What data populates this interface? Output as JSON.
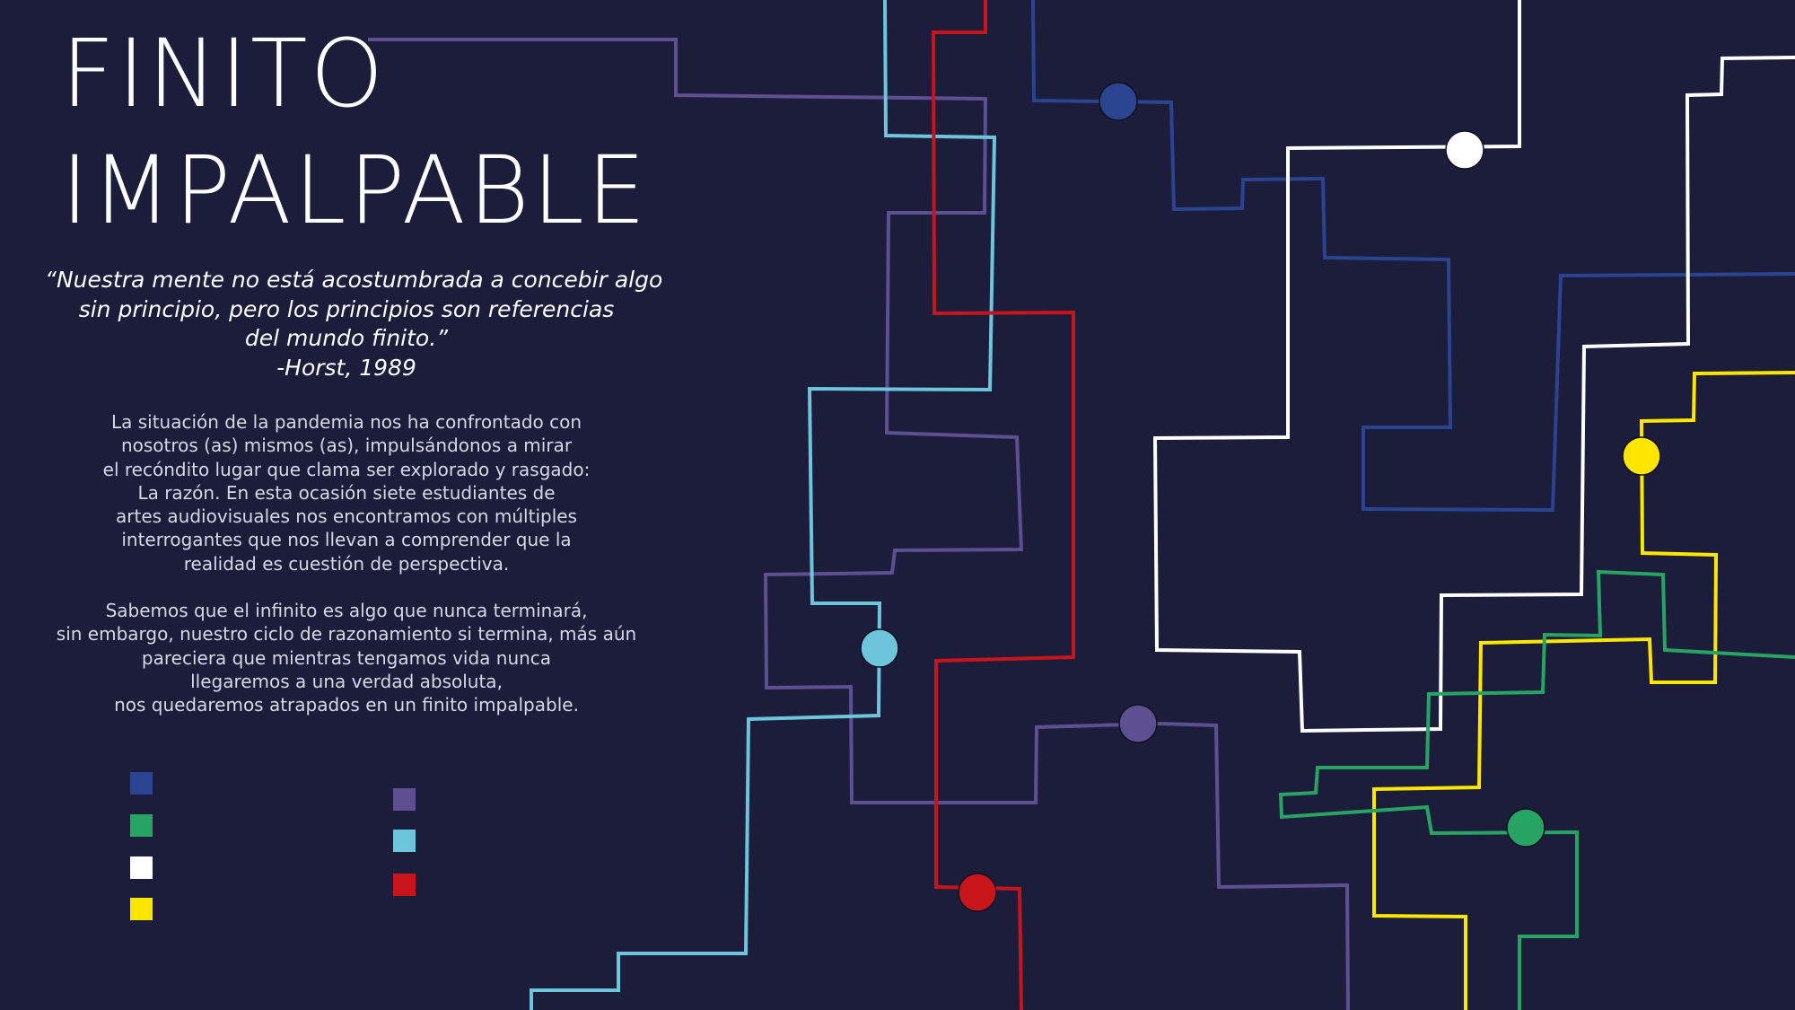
{
  "title": {
    "line1": "FINITO",
    "line2": "IMPALPABLE"
  },
  "quote": {
    "lines": [
      "“Nuestra mente no está acostumbrada a concebir algo",
      "sin principio, pero los principios son referencias",
      "del mundo finito.”",
      "-Horst, 1989"
    ]
  },
  "paragraphs": [
    [
      "La situación de la pandemia nos ha confrontado con",
      "nosotros (as) mismos (as), impulsándonos a mirar",
      "el recóndito lugar que clama ser explorado y rasgado:",
      "La razón. En esta ocasión siete estudiantes de",
      "artes audiovisuales nos encontramos con múltiples",
      "interrogantes que nos llevan a comprender que la",
      "realidad es cuestión de perspectiva."
    ],
    [
      "Sabemos que el infinito es algo que nunca terminará,",
      "sin embargo, nuestro ciclo de razonamiento si termina, más aún",
      "pareciera que mientras tengamos vida nunca",
      "llegaremos a una verdad absoluta,",
      "nos quedaremos atrapados en un finito impalpable."
    ]
  ],
  "colors": {
    "background": "#1c1c3b",
    "purple": "#5d4f92",
    "cyan": "#6cc5db",
    "red": "#c8151b",
    "blue": "#2b4492",
    "white": "#ffffff",
    "yellow": "#ffe600",
    "green": "#27a463"
  },
  "legend_swatches": {
    "left": [
      "blue",
      "green",
      "white",
      "yellow"
    ],
    "right": [
      "purple",
      "cyan",
      "red"
    ]
  }
}
